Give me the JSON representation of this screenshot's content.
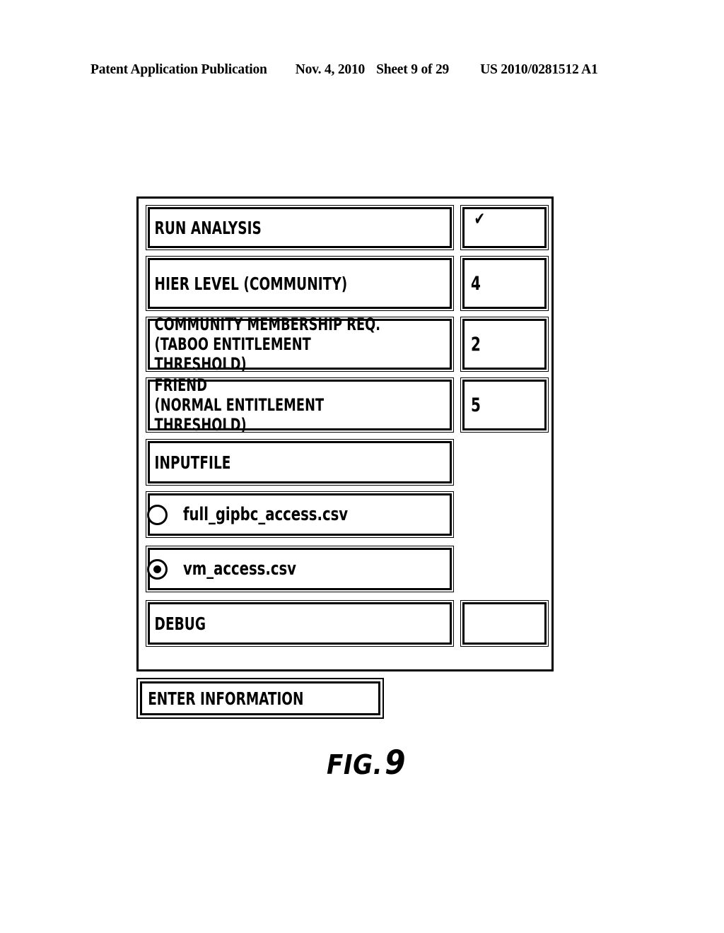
{
  "header": {
    "publication": "Patent Application Publication",
    "date": "Nov. 4, 2010",
    "sheet": "Sheet 9 of 29",
    "document_number": "US 2010/0281512 A1"
  },
  "figure": {
    "caption_prefix": "FIG.",
    "caption_number": "9"
  },
  "form": {
    "rows": [
      {
        "label": "RUN ANALYSIS",
        "value": "",
        "check": "✔"
      },
      {
        "label": "HIER LEVEL (COMMUNITY)",
        "value": "4"
      },
      {
        "label": "COMMUNITY MEMBERSHIP REQ.\n (TABOO ENTITLEMENT THRESHOLD)",
        "value": "2"
      },
      {
        "label": "FRIEND\n (NORMAL ENTITLEMENT THRESHOLD)",
        "value": "5"
      },
      {
        "label": "INPUTFILE",
        "value": ""
      },
      {
        "label": "DEBUG",
        "value": ""
      }
    ],
    "input_file_options": [
      {
        "label": "full_gipbc_access.csv",
        "selected": false
      },
      {
        "label": "vm_access.csv",
        "selected": true
      }
    ],
    "enter_information_label": "ENTER INFORMATION"
  },
  "colors": {
    "ink": "#000000",
    "paper": "#ffffff"
  }
}
